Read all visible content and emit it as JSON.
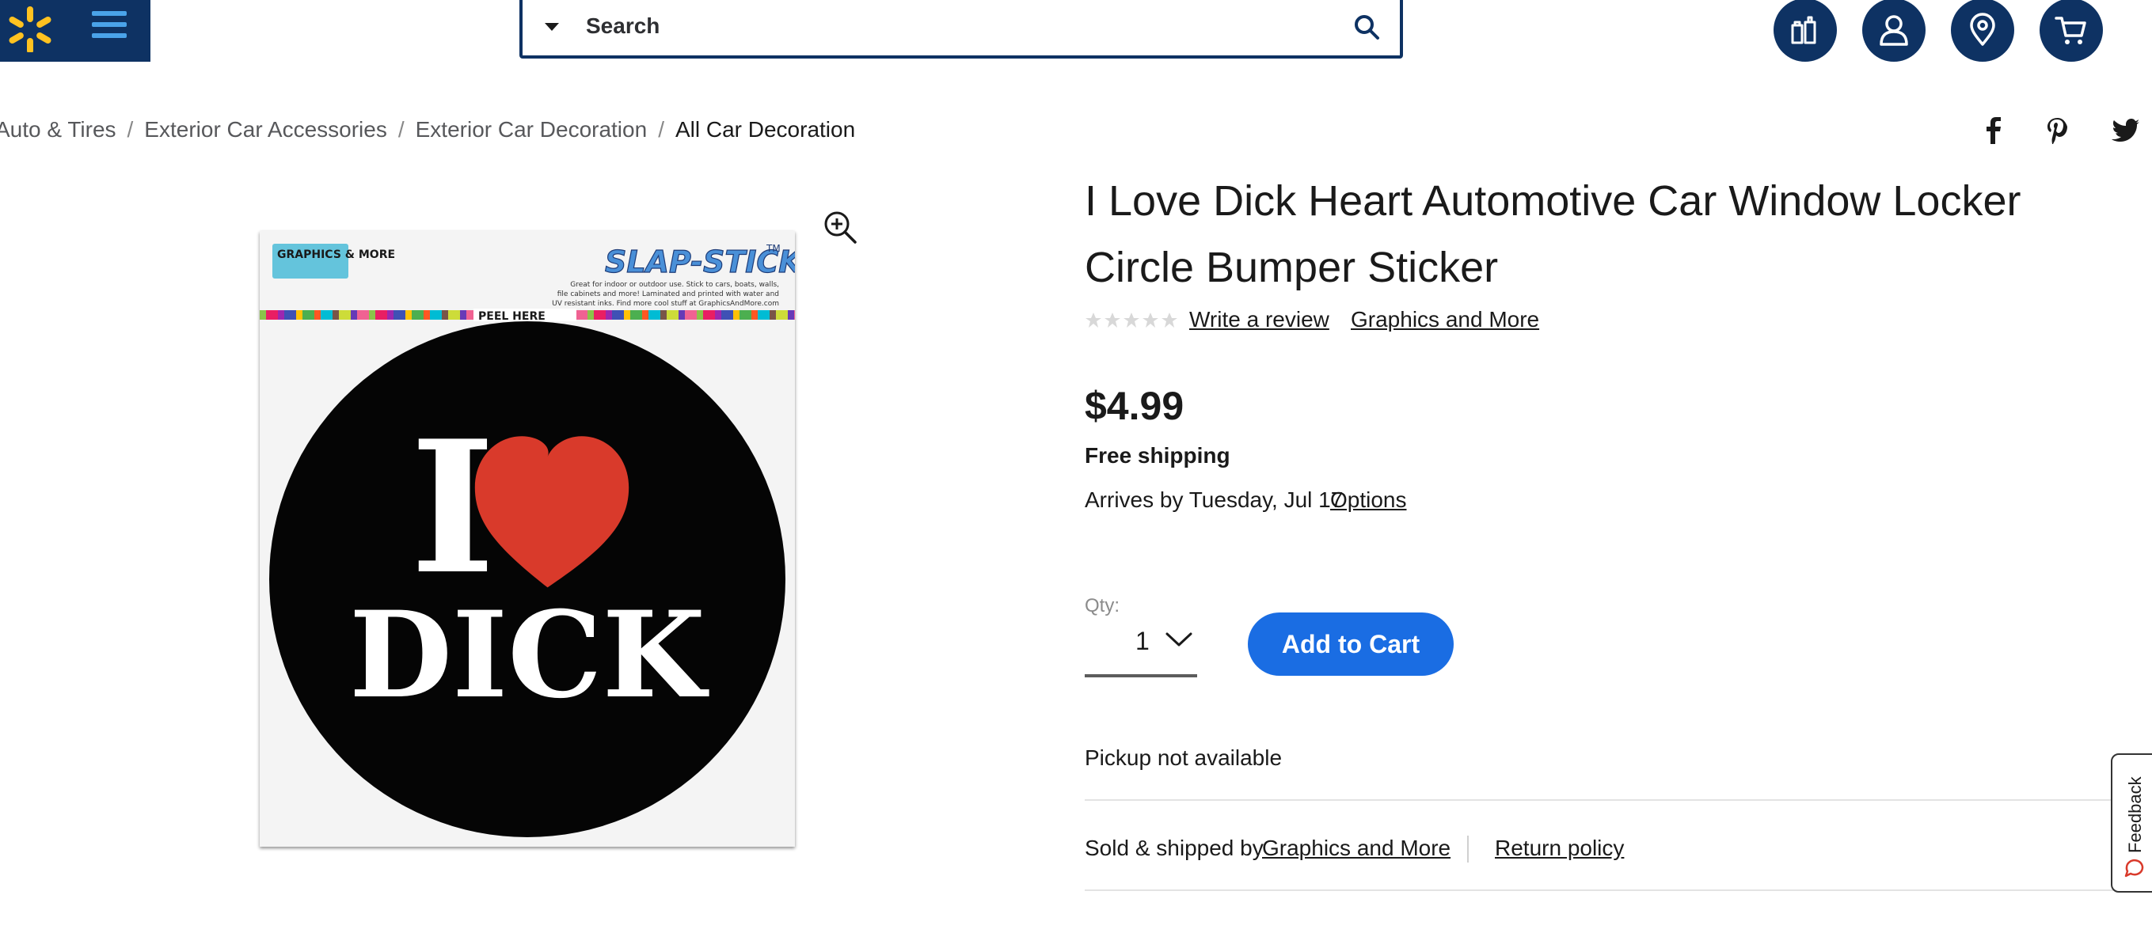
{
  "header": {
    "search": {
      "label": "Search"
    }
  },
  "breadcrumb": {
    "items": [
      {
        "label": "Auto & Tires"
      },
      {
        "label": "Exterior Car Accessories"
      },
      {
        "label": "Exterior Car Decoration"
      },
      {
        "label": "All Car Decoration"
      }
    ],
    "separator": "/"
  },
  "share": {
    "icons": [
      "facebook-icon",
      "pinterest-icon",
      "twitter-icon"
    ]
  },
  "product": {
    "title": "I Love Dick Heart Automotive Car Window Locker Circle Bumper Sticker",
    "rating_stars": 0,
    "write_review": "Write a review",
    "brand": "Graphics and More",
    "price": "$4.99",
    "shipping": "Free shipping",
    "arrives": "Arrives by Tuesday, Jul 17",
    "options": "Options",
    "qty_label": "Qty:",
    "qty_value": "1",
    "add_to_cart": "Add to Cart",
    "pickup": "Pickup not available",
    "sold_shipped_by": "Sold & shipped by",
    "seller": "Graphics and More",
    "return_policy": "Return policy"
  },
  "image": {
    "sticker_brand": "GRAPHICS & MORE",
    "sticker_line": "SLAP-STICKZ",
    "sticker_tm": "TM",
    "sticker_fineprint": [
      "Great for indoor or outdoor use. Stick to cars, boats, walls,",
      "file cabinets and more! Laminated and printed with water and",
      "UV resistant inks. Find more cool stuff at GraphicsAndMore.com"
    ],
    "peel_here": "PEEL HERE",
    "line1": "I",
    "line2": "DICK"
  },
  "feedback": {
    "label": "Feedback"
  },
  "colors": {
    "brand_navy": "#0e3263",
    "spark_yellow": "#ffc220",
    "button_blue": "#1a6de3",
    "heart_red": "#d93a2b"
  }
}
